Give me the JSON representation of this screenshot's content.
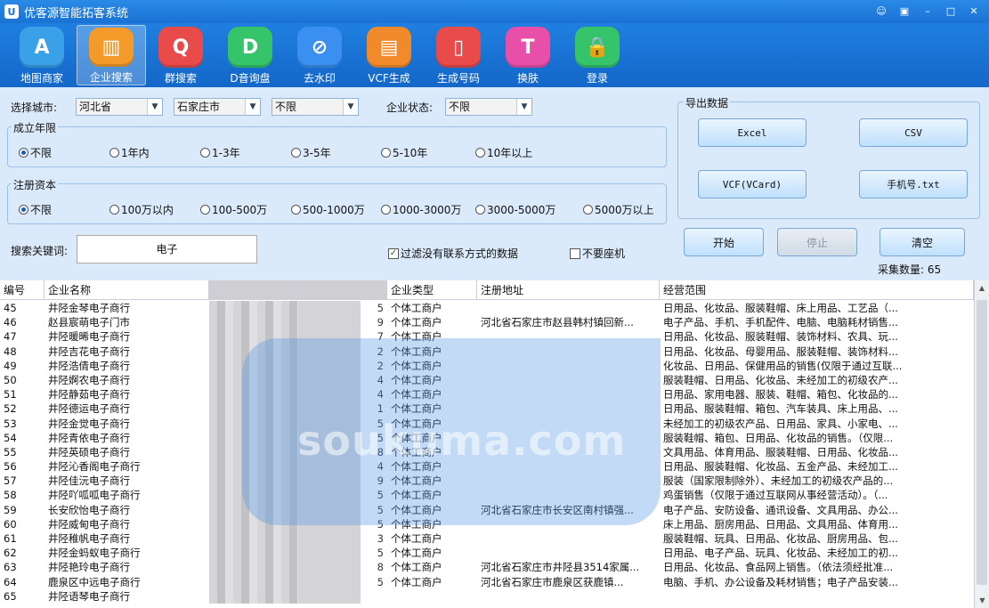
{
  "window": {
    "title": "优客源智能拓客系统",
    "logo_text": "U",
    "controls": [
      "☺",
      "▣",
      "–",
      "□",
      "✕"
    ]
  },
  "toolbar": [
    {
      "label": "地图商家",
      "icon": "map-icon",
      "color": "#3aa0e8",
      "glyph": "A"
    },
    {
      "label": "企业搜索",
      "icon": "building-icon",
      "color": "#f39a2a",
      "glyph": "▥"
    },
    {
      "label": "群搜索",
      "icon": "group-search-icon",
      "color": "#e94b4b",
      "glyph": "Q"
    },
    {
      "label": "D音询盘",
      "icon": "douyin-icon",
      "color": "#35c46a",
      "glyph": "D"
    },
    {
      "label": "去水印",
      "icon": "watermark-icon",
      "color": "#3b8ff0",
      "glyph": "⊘"
    },
    {
      "label": "VCF生成",
      "icon": "vcf-icon",
      "color": "#f08a2a",
      "glyph": "▤"
    },
    {
      "label": "生成号码",
      "icon": "phone-icon",
      "color": "#e94b4b",
      "glyph": "▯"
    },
    {
      "label": "换肤",
      "icon": "shirt-icon",
      "color": "#e84fa8",
      "glyph": "T"
    },
    {
      "label": "登录",
      "icon": "lock-icon",
      "color": "#35c46a",
      "glyph": "🔒"
    }
  ],
  "filters": {
    "city_label": "选择城市:",
    "province": "河北省",
    "city": "石家庄市",
    "district": "不限",
    "status_label": "企业状态:",
    "status": "不限"
  },
  "founded": {
    "title": "成立年限",
    "options": [
      "不限",
      "1年内",
      "1-3年",
      "3-5年",
      "5-10年",
      "10年以上"
    ],
    "selected": 0
  },
  "capital": {
    "title": "注册资本",
    "options": [
      "不限",
      "100万以内",
      "100-500万",
      "500-1000万",
      "1000-3000万",
      "3000-5000万",
      "5000万以上"
    ],
    "selected": 0
  },
  "keyword": {
    "label": "搜索关键词:",
    "value": "电子"
  },
  "checks": {
    "filter_no_contact": {
      "label": "过滤没有联系方式的数据",
      "checked": true
    },
    "no_landline": {
      "label": "不要座机",
      "checked": false
    }
  },
  "export": {
    "title": "导出数据",
    "excel": "Excel",
    "csv": "CSV",
    "vcf": "VCF(VCard)",
    "phone_txt": "手机号.txt"
  },
  "actions": {
    "start": "开始",
    "stop": "停止",
    "clear": "清空"
  },
  "collect_count": "采集数量: 65",
  "table": {
    "columns": [
      "编号",
      "企业名称",
      "",
      "",
      "企业类型",
      "注册地址",
      "经营范围"
    ],
    "rows": [
      [
        "45",
        "井陉金琴电子商行",
        "",
        "5",
        "个体工商户",
        "",
        "日用品、化妆品、服装鞋帽、床上用品、工艺品（..."
      ],
      [
        "46",
        "赵县宸萌电子门市",
        "",
        "9",
        "个体工商户",
        "河北省石家庄市赵县韩村镇回新...",
        "电子产品、手机、手机配件、电脑、电脑耗材销售..."
      ],
      [
        "47",
        "井陉暖晞电子商行",
        "",
        "7",
        "个体工商户",
        "",
        "日用品、化妆品、服装鞋帽、装饰材料、农具、玩..."
      ],
      [
        "48",
        "井陉吉花电子商行",
        "",
        "2",
        "个体工商户",
        "",
        "日用品、化妆品、母婴用品、服装鞋帽、装饰材料..."
      ],
      [
        "49",
        "井陉浩倩电子商行",
        "",
        "2",
        "个体工商户",
        "",
        "化妆品、日用品、保健用品的销售(仅限于通过互联..."
      ],
      [
        "50",
        "井陉婀农电子商行",
        "",
        "4",
        "个体工商户",
        "",
        "服装鞋帽、日用品、化妆品、未经加工的初级农产..."
      ],
      [
        "51",
        "井陉静茹电子商行",
        "",
        "4",
        "个体工商户",
        "",
        "日用品、家用电器、服装、鞋帽、箱包、化妆品的..."
      ],
      [
        "52",
        "井陉德运电子商行",
        "",
        "1",
        "个体工商户",
        "",
        "日用品、服装鞋帽、箱包、汽车装具、床上用品、..."
      ],
      [
        "53",
        "井陉金觉电子商行",
        "",
        "5",
        "个体工商户",
        "",
        "未经加工的初级农产品、日用品、家具、小家电、..."
      ],
      [
        "54",
        "井陉青依电子商行",
        "",
        "5",
        "个体工商户",
        "",
        "服装鞋帽、箱包、日用品、化妆品的销售。（仅限..."
      ],
      [
        "55",
        "井陉英硕电子商行",
        "",
        "8",
        "个体工商户",
        "",
        "文具用品、体育用品、服装鞋帽、日用品、化妆品..."
      ],
      [
        "56",
        "井陉沁香阁电子商行",
        "",
        "4",
        "个体工商户",
        "",
        "日用品、服装鞋帽、化妆品、五金产品、未经加工..."
      ],
      [
        "57",
        "井陉佳沅电子商行",
        "",
        "9",
        "个体工商户",
        "",
        "服装（国家限制除外）、未经加工的初级农产品的..."
      ],
      [
        "58",
        "井陉吖呱呱电子商行",
        "",
        "5",
        "个体工商户",
        "",
        "鸡蛋销售（仅限于通过互联网从事经营活动）。（..."
      ],
      [
        "59",
        "长安欣怡电子商行",
        "",
        "5",
        "个体工商户",
        "河北省石家庄市长安区南村镇强...",
        "电子产品、安防设备、通讯设备、文具用品、办公..."
      ],
      [
        "60",
        "井陉威甸电子商行",
        "",
        "5",
        "个体工商户",
        "",
        "床上用品、厨房用品、日用品、文具用品、体育用..."
      ],
      [
        "61",
        "井陉稚帆电子商行",
        "",
        "3",
        "个体工商户",
        "",
        "服装鞋帽、玩具、日用品、化妆品、厨房用品、包..."
      ],
      [
        "62",
        "井陉金蚂蚁电子商行",
        "",
        "5",
        "个体工商户",
        "",
        "日用品、电子产品、玩具、化妆品、未经加工的初..."
      ],
      [
        "63",
        "井陉艳玲电子商行",
        "",
        "8",
        "个体工商户",
        "河北省石家庄市井陉县3514家属...",
        "日用品、化妆品、食品网上销售。（依法须经批准..."
      ],
      [
        "64",
        "鹿泉区中远电子商行",
        "",
        "5",
        "个体工商户",
        "河北省石家庄市鹿泉区获鹿镇...",
        "电脑、手机、办公设备及耗材销售；电子产品安装..."
      ],
      [
        "65",
        "井陉语琴电子商行",
        "",
        "",
        "",
        "",
        ""
      ]
    ]
  },
  "watermark": "soukuma.com"
}
